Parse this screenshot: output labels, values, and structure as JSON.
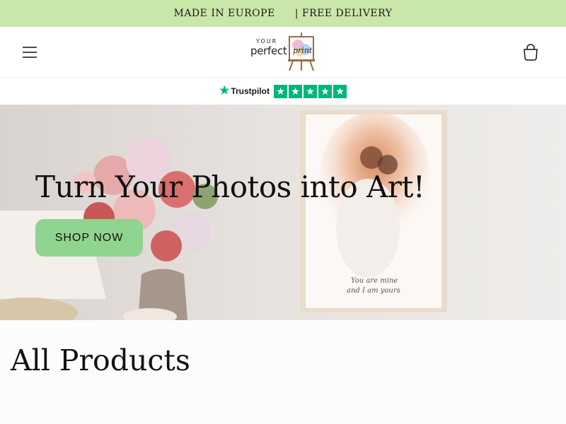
{
  "announcement": {
    "left": "MADE IN EUROPE",
    "right": "| FREE DELIVERY"
  },
  "header": {
    "logo": {
      "line1": "YOUR",
      "line2": "perfect",
      "line3": "print"
    },
    "icons": [
      "hamburger-menu-icon",
      "cart-icon"
    ]
  },
  "trustpilot": {
    "label": "Trustpilot",
    "stars": 5
  },
  "hero": {
    "title": "Turn Your Photos into Art!",
    "button_label": "SHOP NOW",
    "frame_caption_line1": "You are mine",
    "frame_caption_line2": "and I am yours"
  },
  "section": {
    "title": "All Products"
  },
  "colors": {
    "announcement_bg": "#c9e7a9",
    "button_bg": "#8fd48f",
    "trustpilot_green": "#00b67a"
  }
}
